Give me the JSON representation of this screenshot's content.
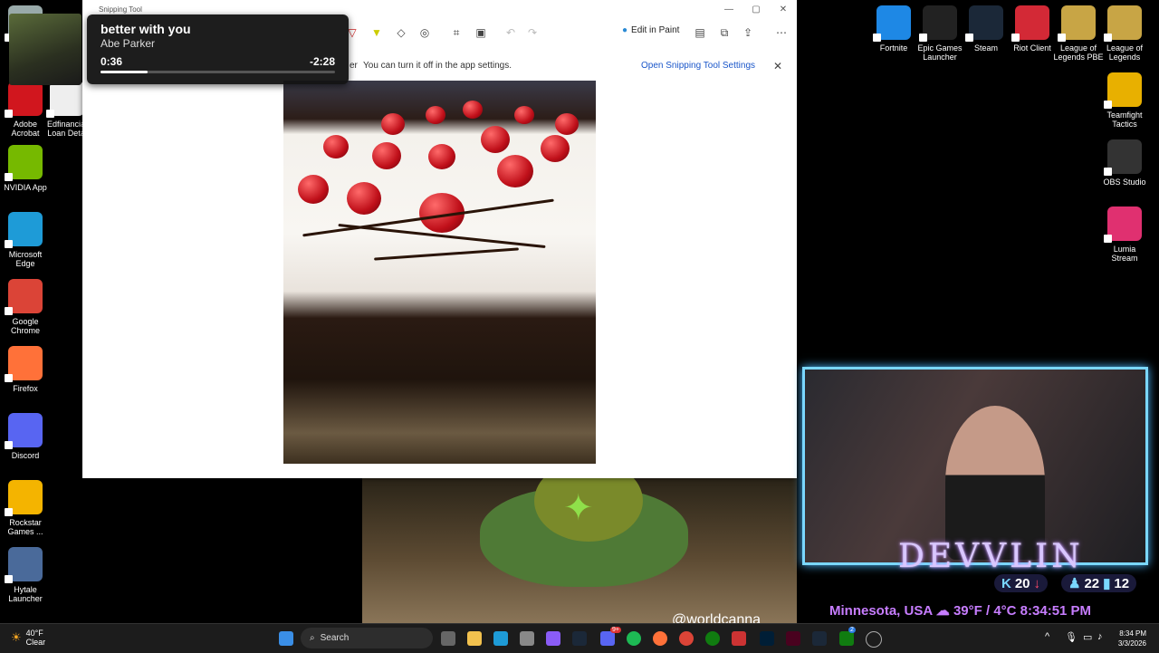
{
  "desktop_left": [
    {
      "label": "Re",
      "icon": "recycle-bin-icon",
      "color": "#9aa",
      "name": "desktop-icon-recycle-bin"
    },
    {
      "label": "Adobe Acrobat",
      "icon": "acrobat-icon",
      "color": "#d1161e",
      "name": "desktop-icon-adobe-acrobat"
    },
    {
      "label": "Edfinancial Loan Detai",
      "icon": "pdf-icon",
      "color": "#eee",
      "name": "desktop-icon-edfinancial"
    },
    {
      "label": "NVIDIA App",
      "icon": "nvidia-icon",
      "color": "#76b900",
      "name": "desktop-icon-nvidia"
    },
    {
      "label": "Microsoft Edge",
      "icon": "edge-icon",
      "color": "#1e9bd7",
      "name": "desktop-icon-edge"
    },
    {
      "label": "Google Chrome",
      "icon": "chrome-icon",
      "color": "#db4437",
      "name": "desktop-icon-chrome"
    },
    {
      "label": "Firefox",
      "icon": "firefox-icon",
      "color": "#ff7139",
      "name": "desktop-icon-firefox"
    },
    {
      "label": "Discord",
      "icon": "discord-icon",
      "color": "#5865f2",
      "name": "desktop-icon-discord"
    },
    {
      "label": "Rockstar Games ...",
      "icon": "rockstar-icon",
      "color": "#f4b400",
      "name": "desktop-icon-rockstar"
    },
    {
      "label": "Hytale Launcher",
      "icon": "hytale-icon",
      "color": "#4a6a9a",
      "name": "desktop-icon-hytale"
    }
  ],
  "desktop_right": [
    {
      "label": "Fortnite",
      "icon": "fortnite-icon",
      "color": "#1e88e5",
      "name": "desktop-icon-fortnite"
    },
    {
      "label": "Epic Games Launcher",
      "icon": "epic-icon",
      "color": "#222",
      "name": "desktop-icon-epic"
    },
    {
      "label": "Steam",
      "icon": "steam-icon",
      "color": "#1b2838",
      "name": "desktop-icon-steam"
    },
    {
      "label": "Riot Client",
      "icon": "riot-icon",
      "color": "#d32936",
      "name": "desktop-icon-riot"
    },
    {
      "label": "League of Legends PBE",
      "icon": "lol-pbe-icon",
      "color": "#c8a545",
      "name": "desktop-icon-lol-pbe"
    },
    {
      "label": "League of Legends",
      "icon": "lol-icon",
      "color": "#c8a545",
      "name": "desktop-icon-lol"
    },
    {
      "label": "Teamfight Tactics",
      "icon": "tft-icon",
      "color": "#e8b000",
      "name": "desktop-icon-tft"
    },
    {
      "label": "OBS Studio",
      "icon": "obs-icon",
      "color": "#333",
      "name": "desktop-icon-obs"
    },
    {
      "label": "Lumia Stream",
      "icon": "lumia-icon",
      "color": "#e03070",
      "name": "desktop-icon-lumia"
    }
  ],
  "snipping_tool": {
    "title": "Snipping Tool",
    "edit_in_paint": "Edit in Paint",
    "notice_message": "You can turn it off in the app settings.",
    "notice_link": "Open Snipping Tool Settings",
    "notice_partial": "er"
  },
  "media": {
    "song": "better with you",
    "artist": "Abe Parker",
    "current_time": "0:36",
    "remaining_time": "-2:28",
    "progress": 0.2
  },
  "stream": {
    "name": "DEVVLIN",
    "stat1": "20",
    "stat2": "22",
    "stat3": "12",
    "location": "Minnesota, USA",
    "weather": "39°F / 4°C",
    "time": "8:34:51 PM",
    "watermark": "@worldcanna"
  },
  "taskbar": {
    "temp": "40°F",
    "condition": "Clear",
    "search_placeholder": "Search",
    "time": "8:34 PM",
    "date": "3/3/2026",
    "badge1": "9+",
    "badge2": "2"
  },
  "colors": {
    "accent": "#7ad7ff",
    "overlay_purple": "#c77dff"
  }
}
